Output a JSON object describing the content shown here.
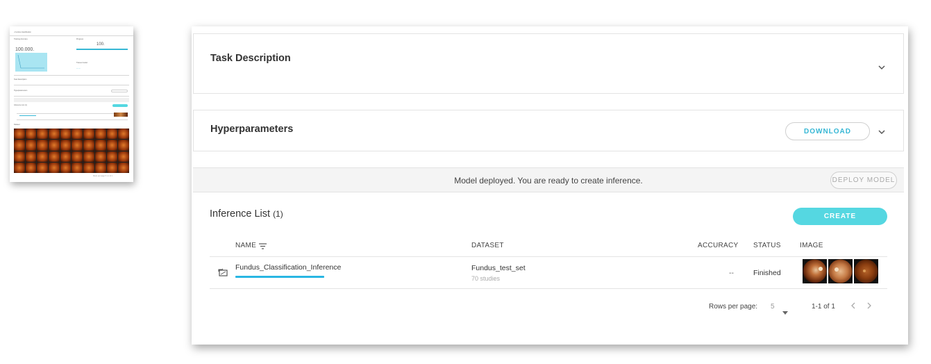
{
  "task_description": {
    "title": "Task Description"
  },
  "hyperparameters": {
    "title": "Hyperparameters",
    "download_label": "DOWNLOAD"
  },
  "deploy": {
    "message": "Model deployed. You are ready to create inference.",
    "button_label": "DEPLOY MODEL"
  },
  "inference": {
    "title": "Inference List",
    "count": "(1)",
    "create_label": "CREATE",
    "columns": {
      "name": "NAME",
      "dataset": "DATASET",
      "accuracy": "ACCURACY",
      "status": "STATUS",
      "image": "IMAGE"
    },
    "rows": [
      {
        "name": "Fundus_Classification_Inference",
        "dataset": "Fundus_test_set",
        "dataset_sub": "70 studies",
        "accuracy": "--",
        "status": "Finished",
        "progress": 1.0
      }
    ],
    "footer": {
      "rows_per_page_label": "Rows per page:",
      "rows_per_page_value": "5",
      "range": "1-1 of 1"
    }
  },
  "thumbnail": {
    "big_value": "100.000.",
    "right_value": "100.",
    "grid_tiles": 40
  },
  "colors": {
    "accent": "#36b7d5",
    "create": "#55d7e1",
    "progress": "#29b6e3"
  }
}
